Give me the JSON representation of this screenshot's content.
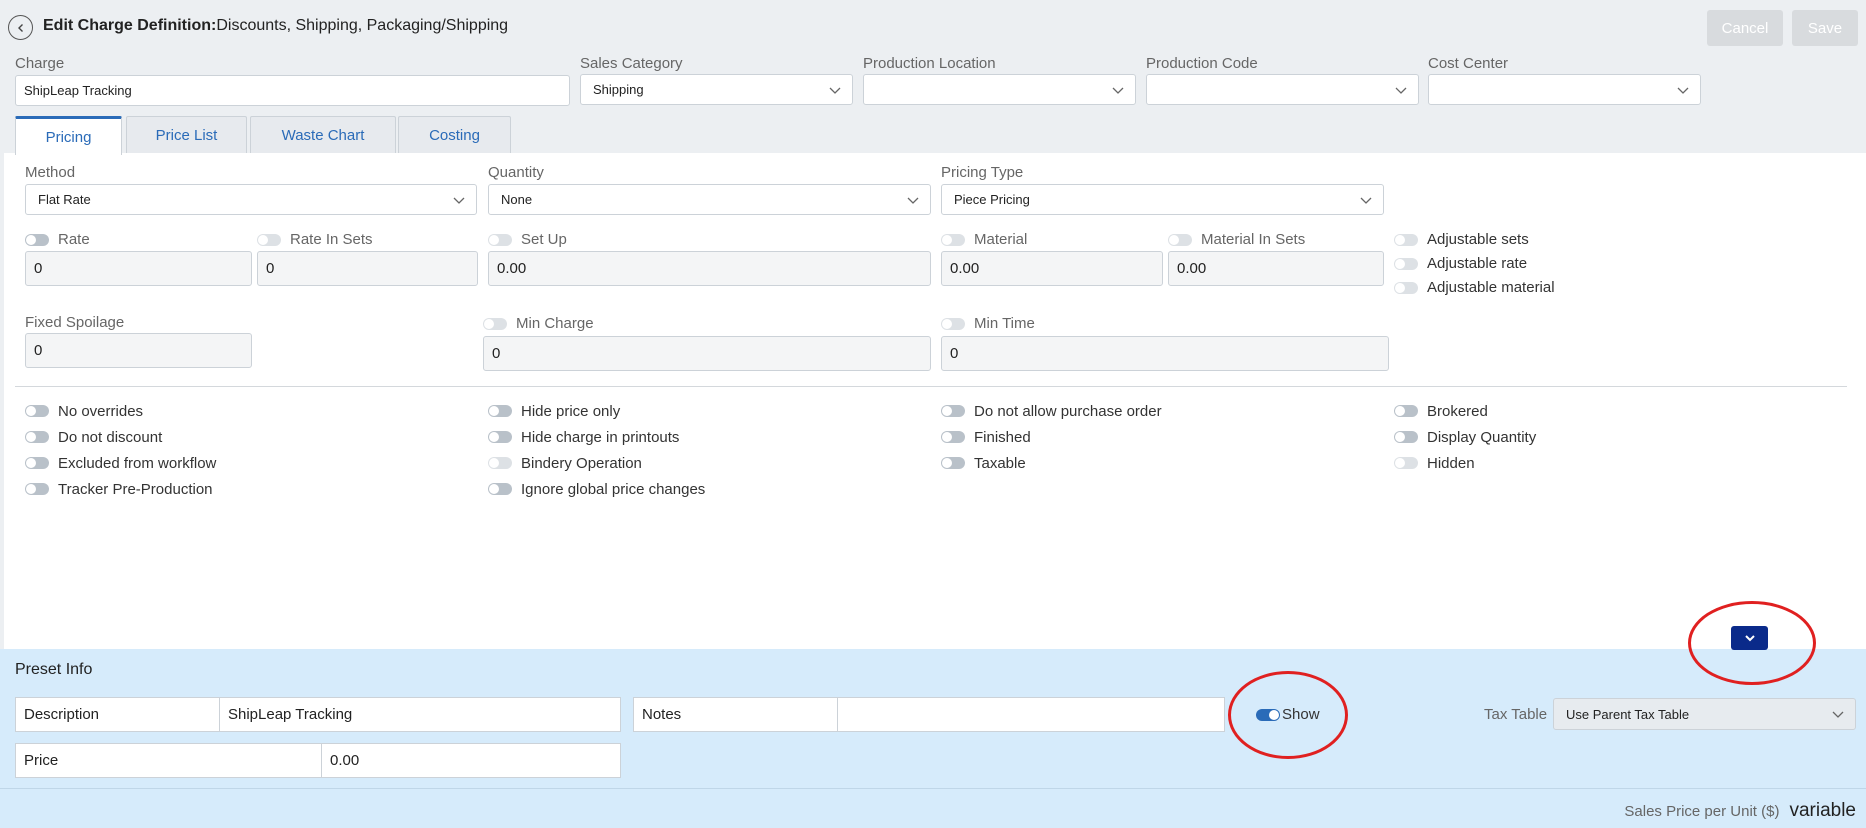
{
  "header": {
    "title_bold": "Edit Charge Definition:",
    "title_rest": "Discounts, Shipping, Packaging/Shipping",
    "cancel_label": "Cancel",
    "save_label": "Save"
  },
  "top_fields": {
    "charge_label": "Charge",
    "charge_value": "ShipLeap Tracking",
    "sales_category_label": "Sales Category",
    "sales_category_value": "Shipping",
    "production_location_label": "Production Location",
    "production_location_value": "",
    "production_code_label": "Production Code",
    "production_code_value": "",
    "cost_center_label": "Cost Center",
    "cost_center_value": ""
  },
  "tabs": [
    "Pricing",
    "Price List",
    "Waste Chart",
    "Costing"
  ],
  "pricing": {
    "method_label": "Method",
    "method_value": "Flat Rate",
    "quantity_label": "Quantity",
    "quantity_value": "None",
    "pricing_type_label": "Pricing Type",
    "pricing_type_value": "Piece Pricing",
    "rate_label": "Rate",
    "rate_value": "0",
    "rate_in_sets_label": "Rate In Sets",
    "rate_in_sets_value": "0",
    "setup_label": "Set Up",
    "setup_value": "0.00",
    "material_label": "Material",
    "material_value": "0.00",
    "material_in_sets_label": "Material In Sets",
    "material_in_sets_value": "0.00",
    "adjustable": [
      "Adjustable sets",
      "Adjustable rate",
      "Adjustable material"
    ],
    "fixed_spoilage_label": "Fixed Spoilage",
    "fixed_spoilage_value": "0",
    "min_charge_label": "Min Charge",
    "min_charge_value": "0",
    "min_time_label": "Min Time",
    "min_time_value": "0"
  },
  "options": {
    "col1": [
      "No overrides",
      "Do not discount",
      "Excluded from workflow",
      "Tracker Pre-Production"
    ],
    "col2": [
      "Hide price only",
      "Hide charge in printouts",
      "Bindery Operation",
      "Ignore global price changes"
    ],
    "col3": [
      "Do not allow purchase order",
      "Finished",
      "Taxable"
    ],
    "col4": [
      "Brokered",
      "Display Quantity",
      "Hidden"
    ]
  },
  "preset": {
    "title": "Preset Info",
    "description_label": "Description",
    "description_value": "ShipLeap Tracking",
    "notes_label": "Notes",
    "notes_value": "",
    "show_label": "Show",
    "show_on": true,
    "tax_table_label": "Tax Table",
    "tax_table_value": "Use Parent Tax Table",
    "price_label": "Price",
    "price_value": "0.00"
  },
  "footer": {
    "sales_price_label": "Sales Price per Unit ($)",
    "sales_price_value": "variable"
  },
  "colors": {
    "accent": "#2a6bb8",
    "preset_bg": "#d6ebfb",
    "annotation": "#e02020",
    "expand_button": "#0a2a8a"
  }
}
